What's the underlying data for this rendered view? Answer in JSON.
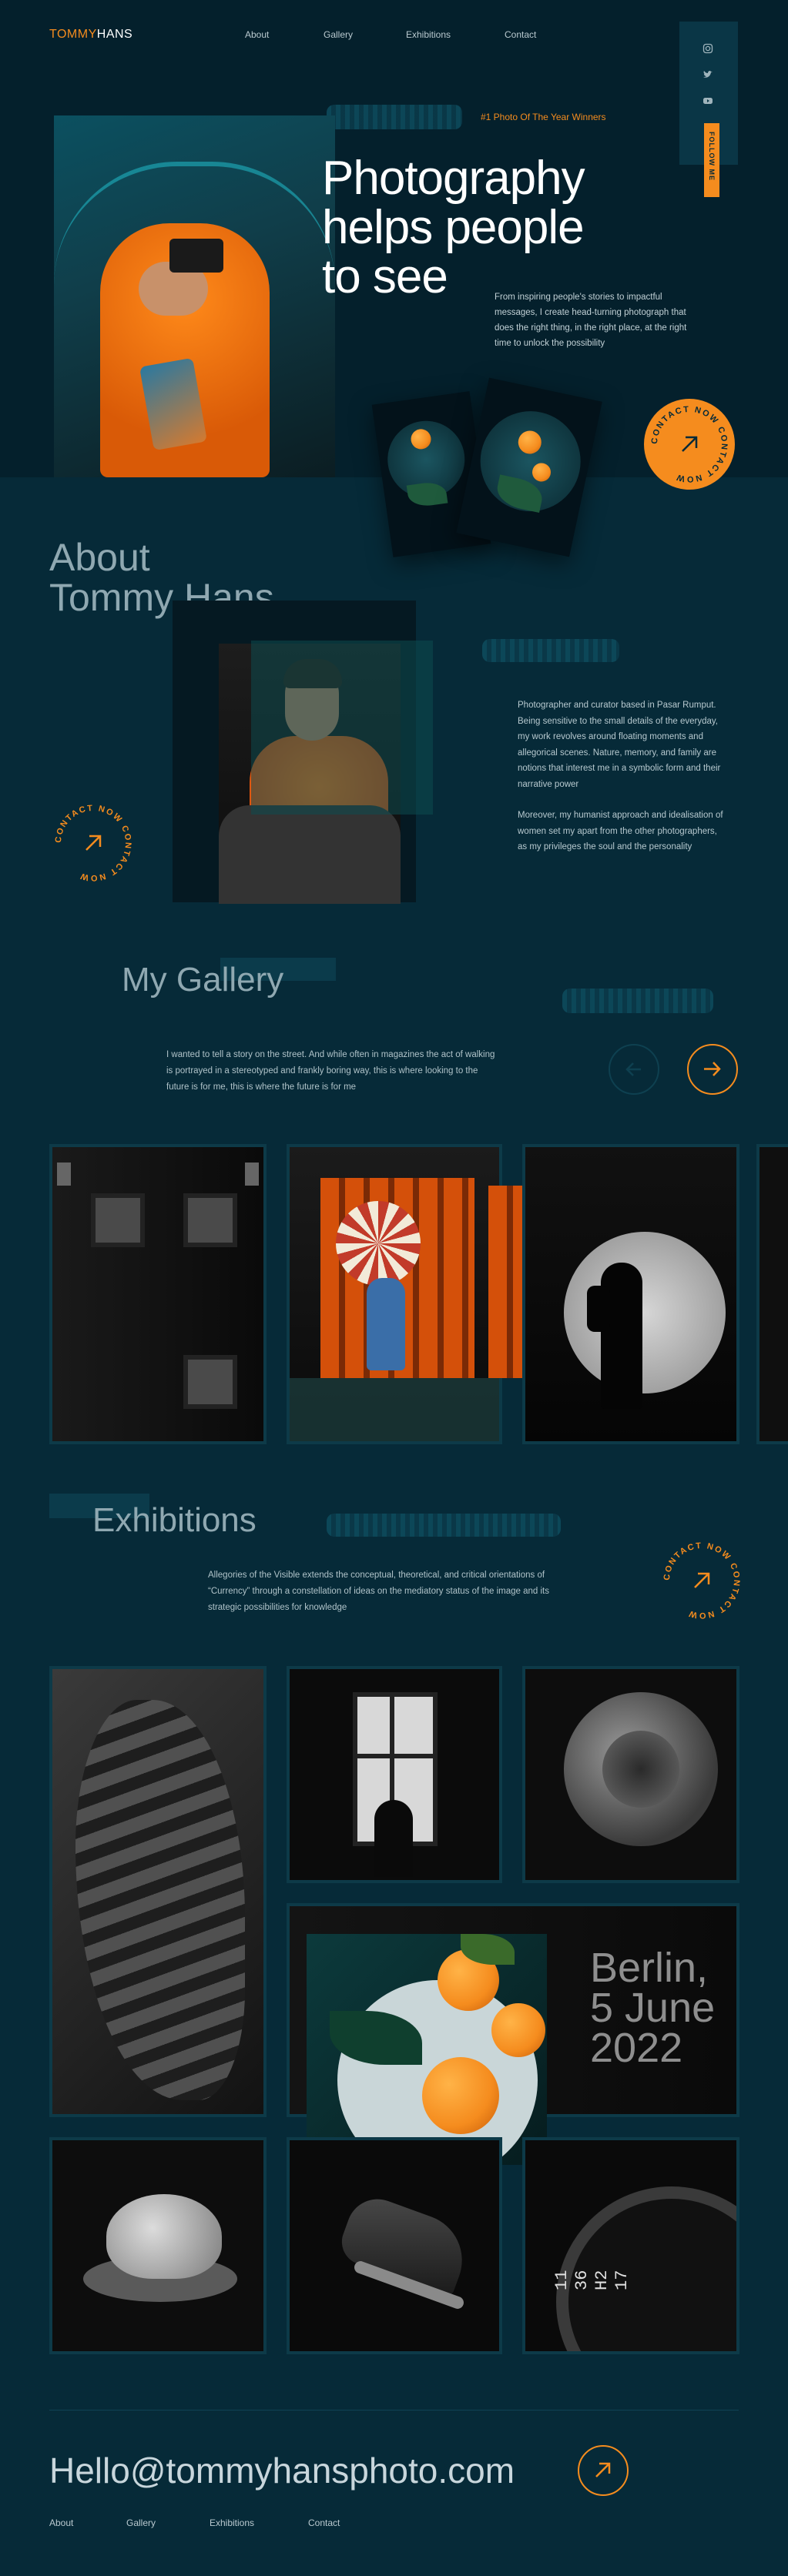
{
  "brand": {
    "first": "TOMMY",
    "last": "HANS"
  },
  "nav": {
    "about": "About",
    "gallery": "Gallery",
    "exhibitions": "Exhibitions",
    "contact": "Contact"
  },
  "social": {
    "icons": [
      "instagram-icon",
      "twitter-icon",
      "youtube-icon"
    ],
    "follow_label": "FOLLOW ME"
  },
  "hero": {
    "badge": "#1 Photo Of The Year Winners",
    "title_line1": "Photography",
    "title_line2": "helps people",
    "title_line3": "to see",
    "description": "From inspiring people's stories to impactful messages, I create head-turning photograph that does the right thing, in the right place, at the right time to unlock the possibility",
    "contact_badge": "CONTACT NOW CONTACT NOW "
  },
  "about": {
    "title_line1": "About",
    "title_line2": "Tommy Hans",
    "paragraph1": "Photographer and curator based in Pasar Rumput. Being sensitive to the small details of the everyday, my work revolves around floating moments and allegorical scenes. Nature, memory, and family are notions that interest me in a symbolic form and their narrative power",
    "paragraph2": "Moreover, my humanist approach and idealisation of women set my apart from the other photographers, as my privileges the soul and the personality",
    "contact_badge": "CONTACT NOW CONTACT NOW "
  },
  "gallery": {
    "title": "My Gallery",
    "description": "I wanted to tell a story on the street. And while often in magazines the act of walking is portrayed in a stereotyped and frankly boring way, this is where looking to the future is for me, this is where the future is for me"
  },
  "exhibitions": {
    "title": "Exhibitions",
    "description": "Allegories of the Visible extends the conceptual, theoretical, and critical orientations of “Currency” through a constellation of ideas on the mediatory status of the image and its strategic possibilities for knowledge",
    "contact_badge": "CONTACT NOW CONTACT NOW ",
    "event_line1": "Berlin,",
    "event_line2": "5 June",
    "event_line3": "2022",
    "watch_text": "11 36 H2 17"
  },
  "footer": {
    "email": "Hello@tommyhansphoto.com",
    "nav": {
      "about": "About",
      "gallery": "Gallery",
      "exhibitions": "Exhibitions",
      "contact": "Contact"
    }
  },
  "colors": {
    "accent": "#f58c1e",
    "background": "#062a38",
    "hero_background": "#04202c",
    "muted_title": "#8fa8b1"
  }
}
